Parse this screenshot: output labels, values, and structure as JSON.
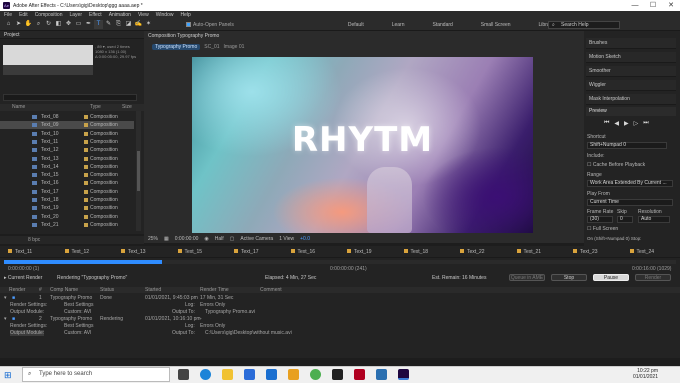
{
  "window": {
    "title": "Adobe After Effects - C:\\Users\\gig\\Desktop\\ggg aaaa.aep *",
    "app_icon": "Ae",
    "controls": [
      "—",
      "☐",
      "✕"
    ]
  },
  "menu": [
    "File",
    "Edit",
    "Composition",
    "Layer",
    "Effect",
    "Animation",
    "View",
    "Window",
    "Help"
  ],
  "toolbar": {
    "auto_open_panels": "Auto-Open Panels",
    "workspaces": [
      "Default",
      "Learn",
      "Standard",
      "Small Screen",
      "Libraries"
    ],
    "search_help": "Search Help"
  },
  "project": {
    "title": "Project",
    "thumb_info": [
      ", 89 ▾, used 2 times",
      "1080 x 136 (1.00)",
      "Δ 0:00:05:00, 29.97 fps"
    ],
    "columns": {
      "name": "Name",
      "type": "Type",
      "size": "Size"
    },
    "items": [
      {
        "name": "Text_08",
        "type": "Composition"
      },
      {
        "name": "Text_09",
        "type": "Composition"
      },
      {
        "name": "Text_10",
        "type": "Composition"
      },
      {
        "name": "Text_11",
        "type": "Composition"
      },
      {
        "name": "Text_12",
        "type": "Composition"
      },
      {
        "name": "Text_13",
        "type": "Composition"
      },
      {
        "name": "Text_14",
        "type": "Composition"
      },
      {
        "name": "Text_15",
        "type": "Composition"
      },
      {
        "name": "Text_16",
        "type": "Composition"
      },
      {
        "name": "Text_17",
        "type": "Composition"
      },
      {
        "name": "Text_18",
        "type": "Composition"
      },
      {
        "name": "Text_19",
        "type": "Composition"
      },
      {
        "name": "Text_20",
        "type": "Composition"
      },
      {
        "name": "Text_21",
        "type": "Composition"
      }
    ],
    "selected_index": 1,
    "footer": "8 bpc"
  },
  "comp": {
    "tab": "Composition Typography Promo",
    "breadcrumbs": [
      "Typography Promo",
      "SC_01",
      "Image 01"
    ],
    "viewer_text": "RHYTM",
    "controls": {
      "zoom": "25%",
      "timecode": "0:00:00:00",
      "resolution": "Half",
      "camera": "Active Camera",
      "views": "1 View",
      "offset": "+0.0"
    }
  },
  "right": {
    "panels": [
      "Brushes",
      "Motion Sketch",
      "Smoother",
      "Wiggler",
      "Mask Interpolation"
    ],
    "preview": {
      "title": "Preview",
      "shortcut_label": "Shortcut",
      "shortcut": "Shift+Numpad 0",
      "include": "Include:",
      "cache": "Cache Before Playback",
      "range_label": "Range",
      "range": "Work Area Extended By Current ...",
      "play_from_label": "Play From",
      "play_from": "Current Time",
      "frame_rate_label": "Frame Rate",
      "skip_label": "Skip",
      "resolution_label": "Resolution",
      "frame_rate": "(30)",
      "skip": "0",
      "resolution": "Auto",
      "full_screen": "Full Screen",
      "stop_text": "On (Shift+Numpad 0) Stop:"
    }
  },
  "timeline_tabs": [
    "Text_11",
    "Text_12",
    "Text_13",
    "Text_15",
    "Text_17",
    "Text_16",
    "Text_19",
    "Text_18",
    "Text_22",
    "Text_21",
    "Text_23",
    "Text_24"
  ],
  "render_queue": {
    "time_left": "0:00:00:00 (1)",
    "time_mid": "0:00:00:00 (241)",
    "time_right": "0:00:16:00 (1029)",
    "current_label": "Current Render",
    "rendering": "Rendering \"Typography Promo\"",
    "elapsed": "Elapsed: 4 Min, 27 Sec",
    "remaining": "Est. Remain: 16 Minutes",
    "buttons": {
      "queue_ame": "Queue in AME",
      "stop": "Stop",
      "pause": "Pause",
      "render": "Render"
    },
    "columns": [
      "Render",
      "#",
      "Comp Name",
      "Status",
      "Started",
      "Render Time",
      "Comment"
    ],
    "jobs": [
      {
        "num": "1",
        "comp": "Typography Promo",
        "status": "Done",
        "started": "01/01/2021, 9:45:03 pm",
        "render_time": "17 Min, 31 Sec",
        "render_settings_label": "Render Settings:",
        "render_settings": "Best Settings",
        "output_module_label": "Output Module:",
        "output_module": "Custom: AVI",
        "log_label": "Log:",
        "log": "Errors Only",
        "output_to_label": "Output To:",
        "output_to": "Typography Promo.avi"
      },
      {
        "num": "2",
        "comp": "Typography Promo",
        "status": "Rendering",
        "started": "01/01/2021, 10:16:10 pm",
        "render_time": "-",
        "render_settings_label": "Render Settings:",
        "render_settings": "Best Settings",
        "output_module_label": "Output Module:",
        "output_module": "Custom: AVI",
        "log_label": "Log:",
        "log": "Errors Only",
        "output_to_label": "Output To:",
        "output_to": "C:\\Users\\gig\\Desktop\\without music.avi"
      }
    ]
  },
  "taskbar": {
    "search_placeholder": "Type here to search",
    "time": "10:22 pm",
    "date": "01/01/2021"
  }
}
